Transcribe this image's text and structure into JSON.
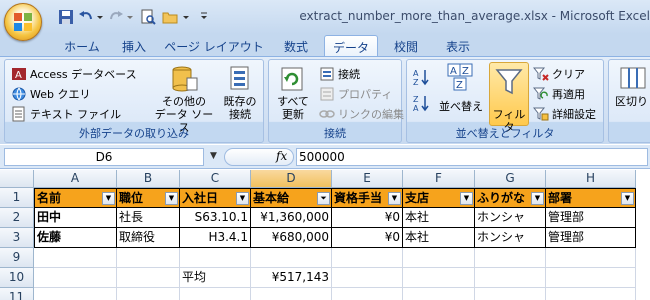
{
  "window": {
    "title": "extract_number_more_than_average.xlsx - Microsoft Excel"
  },
  "tabs": [
    "ホーム",
    "挿入",
    "ページ レイアウト",
    "数式",
    "データ",
    "校閲",
    "表示"
  ],
  "active_tab": "データ",
  "ribbon": {
    "external_data": {
      "label": "外部データの取り込み",
      "access": "Access データベース",
      "web": "Web クエリ",
      "text": "テキスト ファイル",
      "other_line1": "その他の",
      "other_line2": "データ ソース",
      "existing_line1": "既存の",
      "existing_line2": "接続"
    },
    "connections": {
      "label": "接続",
      "refresh_line1": "すべて",
      "refresh_line2": "更新",
      "connections": "接続",
      "properties": "プロパティ",
      "edit_links": "リンクの編集"
    },
    "sort_filter": {
      "label": "並べ替えとフィルタ",
      "sort": "並べ替え",
      "filter": "フィルタ",
      "clear": "クリア",
      "reapply": "再適用",
      "advanced": "詳細設定"
    },
    "data_tools": {
      "text_to_columns": "区切り"
    }
  },
  "formula_bar": {
    "name_box": "D6",
    "fx": "fx",
    "formula": "500000"
  },
  "columns": [
    "A",
    "B",
    "C",
    "D",
    "E",
    "F",
    "G",
    "H"
  ],
  "rows": [
    {
      "num": "1",
      "cells": [
        "名前",
        "職位",
        "入社日",
        "基本給",
        "資格手当",
        "支店",
        "ふりがな",
        "部署"
      ]
    },
    {
      "num": "2",
      "cells": [
        "田中",
        "社長",
        "S63.10.1",
        "¥1,360,000",
        "¥0",
        "本社",
        "ホンシャ",
        "管理部"
      ]
    },
    {
      "num": "3",
      "cells": [
        "佐藤",
        "取締役",
        "H3.4.1",
        "¥680,000",
        "¥0",
        "本社",
        "ホンシャ",
        "管理部"
      ]
    },
    {
      "num": "9",
      "cells": [
        "",
        "",
        "",
        "",
        "",
        "",
        "",
        ""
      ]
    },
    {
      "num": "10",
      "cells": [
        "",
        "",
        "平均",
        "¥517,143",
        "",
        "",
        "",
        ""
      ]
    },
    {
      "num": "11",
      "cells": [
        "",
        "",
        "",
        "",
        "",
        "",
        "",
        ""
      ]
    }
  ],
  "colors": {
    "header_fill": "#f6a31c",
    "ribbon_blue": "#c4d8ef",
    "title_text": "#15428b"
  }
}
